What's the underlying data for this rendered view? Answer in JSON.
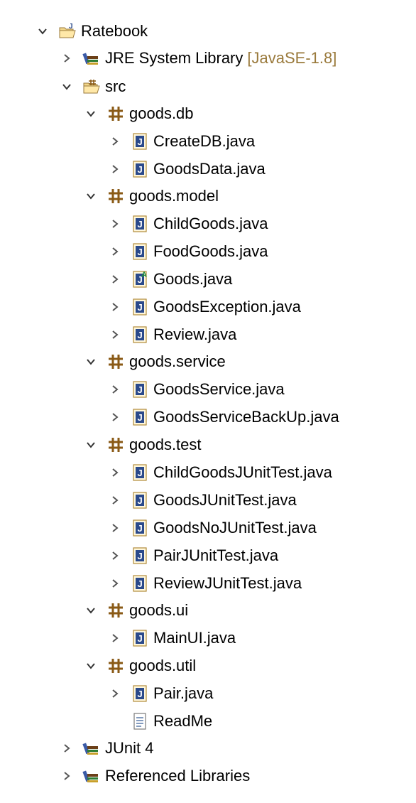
{
  "tree": {
    "project": {
      "label": "Ratebook"
    },
    "jre": {
      "label": "JRE System Library",
      "decoration": "[JavaSE-1.8]"
    },
    "src": {
      "label": "src"
    },
    "pkg_db": {
      "label": "goods.db"
    },
    "file_createdb": {
      "label": "CreateDB.java"
    },
    "file_goodsdata": {
      "label": "GoodsData.java"
    },
    "pkg_model": {
      "label": "goods.model"
    },
    "file_childgoods": {
      "label": "ChildGoods.java"
    },
    "file_foodgoods": {
      "label": "FoodGoods.java"
    },
    "file_goods": {
      "label": "Goods.java"
    },
    "file_goodsexception": {
      "label": "GoodsException.java"
    },
    "file_review": {
      "label": "Review.java"
    },
    "pkg_service": {
      "label": "goods.service"
    },
    "file_goodsservice": {
      "label": "GoodsService.java"
    },
    "file_goodsservicebackup": {
      "label": "GoodsServiceBackUp.java"
    },
    "pkg_test": {
      "label": "goods.test"
    },
    "file_childgoodsjunittest": {
      "label": "ChildGoodsJUnitTest.java"
    },
    "file_goodsjunittest": {
      "label": "GoodsJUnitTest.java"
    },
    "file_goodsnojunittest": {
      "label": "GoodsNoJUnitTest.java"
    },
    "file_pairjunittest": {
      "label": "PairJUnitTest.java"
    },
    "file_reviewjunittest": {
      "label": "ReviewJUnitTest.java"
    },
    "pkg_ui": {
      "label": "goods.ui"
    },
    "file_mainui": {
      "label": "MainUI.java"
    },
    "pkg_util": {
      "label": "goods.util"
    },
    "file_pair": {
      "label": "Pair.java"
    },
    "file_readme": {
      "label": "ReadMe"
    },
    "junit": {
      "label": "JUnit 4"
    },
    "reflibs": {
      "label": "Referenced Libraries"
    }
  },
  "colors": {
    "java_badge": "#2b4a8b",
    "package": "#8a5a16",
    "library": "#3a5aa6",
    "decoration": "#9a7a3c",
    "arrow": "#4a4a4a"
  }
}
